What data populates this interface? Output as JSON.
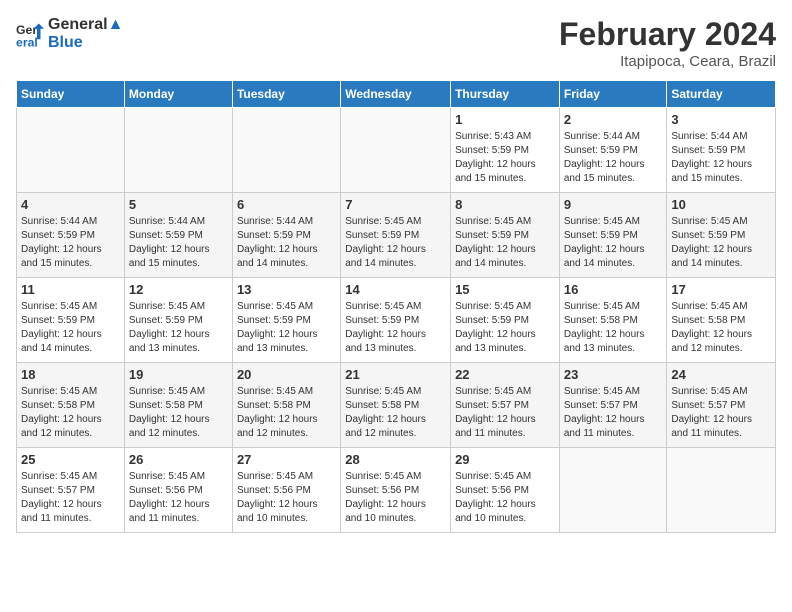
{
  "header": {
    "logo_line1": "General",
    "logo_line2": "Blue",
    "month_year": "February 2024",
    "location": "Itapipoca, Ceara, Brazil"
  },
  "weekdays": [
    "Sunday",
    "Monday",
    "Tuesday",
    "Wednesday",
    "Thursday",
    "Friday",
    "Saturday"
  ],
  "weeks": [
    [
      {
        "day": "",
        "info": ""
      },
      {
        "day": "",
        "info": ""
      },
      {
        "day": "",
        "info": ""
      },
      {
        "day": "",
        "info": ""
      },
      {
        "day": "1",
        "info": "Sunrise: 5:43 AM\nSunset: 5:59 PM\nDaylight: 12 hours\nand 15 minutes."
      },
      {
        "day": "2",
        "info": "Sunrise: 5:44 AM\nSunset: 5:59 PM\nDaylight: 12 hours\nand 15 minutes."
      },
      {
        "day": "3",
        "info": "Sunrise: 5:44 AM\nSunset: 5:59 PM\nDaylight: 12 hours\nand 15 minutes."
      }
    ],
    [
      {
        "day": "4",
        "info": "Sunrise: 5:44 AM\nSunset: 5:59 PM\nDaylight: 12 hours\nand 15 minutes."
      },
      {
        "day": "5",
        "info": "Sunrise: 5:44 AM\nSunset: 5:59 PM\nDaylight: 12 hours\nand 15 minutes."
      },
      {
        "day": "6",
        "info": "Sunrise: 5:44 AM\nSunset: 5:59 PM\nDaylight: 12 hours\nand 14 minutes."
      },
      {
        "day": "7",
        "info": "Sunrise: 5:45 AM\nSunset: 5:59 PM\nDaylight: 12 hours\nand 14 minutes."
      },
      {
        "day": "8",
        "info": "Sunrise: 5:45 AM\nSunset: 5:59 PM\nDaylight: 12 hours\nand 14 minutes."
      },
      {
        "day": "9",
        "info": "Sunrise: 5:45 AM\nSunset: 5:59 PM\nDaylight: 12 hours\nand 14 minutes."
      },
      {
        "day": "10",
        "info": "Sunrise: 5:45 AM\nSunset: 5:59 PM\nDaylight: 12 hours\nand 14 minutes."
      }
    ],
    [
      {
        "day": "11",
        "info": "Sunrise: 5:45 AM\nSunset: 5:59 PM\nDaylight: 12 hours\nand 14 minutes."
      },
      {
        "day": "12",
        "info": "Sunrise: 5:45 AM\nSunset: 5:59 PM\nDaylight: 12 hours\nand 13 minutes."
      },
      {
        "day": "13",
        "info": "Sunrise: 5:45 AM\nSunset: 5:59 PM\nDaylight: 12 hours\nand 13 minutes."
      },
      {
        "day": "14",
        "info": "Sunrise: 5:45 AM\nSunset: 5:59 PM\nDaylight: 12 hours\nand 13 minutes."
      },
      {
        "day": "15",
        "info": "Sunrise: 5:45 AM\nSunset: 5:59 PM\nDaylight: 12 hours\nand 13 minutes."
      },
      {
        "day": "16",
        "info": "Sunrise: 5:45 AM\nSunset: 5:58 PM\nDaylight: 12 hours\nand 13 minutes."
      },
      {
        "day": "17",
        "info": "Sunrise: 5:45 AM\nSunset: 5:58 PM\nDaylight: 12 hours\nand 12 minutes."
      }
    ],
    [
      {
        "day": "18",
        "info": "Sunrise: 5:45 AM\nSunset: 5:58 PM\nDaylight: 12 hours\nand 12 minutes."
      },
      {
        "day": "19",
        "info": "Sunrise: 5:45 AM\nSunset: 5:58 PM\nDaylight: 12 hours\nand 12 minutes."
      },
      {
        "day": "20",
        "info": "Sunrise: 5:45 AM\nSunset: 5:58 PM\nDaylight: 12 hours\nand 12 minutes."
      },
      {
        "day": "21",
        "info": "Sunrise: 5:45 AM\nSunset: 5:58 PM\nDaylight: 12 hours\nand 12 minutes."
      },
      {
        "day": "22",
        "info": "Sunrise: 5:45 AM\nSunset: 5:57 PM\nDaylight: 12 hours\nand 11 minutes."
      },
      {
        "day": "23",
        "info": "Sunrise: 5:45 AM\nSunset: 5:57 PM\nDaylight: 12 hours\nand 11 minutes."
      },
      {
        "day": "24",
        "info": "Sunrise: 5:45 AM\nSunset: 5:57 PM\nDaylight: 12 hours\nand 11 minutes."
      }
    ],
    [
      {
        "day": "25",
        "info": "Sunrise: 5:45 AM\nSunset: 5:57 PM\nDaylight: 12 hours\nand 11 minutes."
      },
      {
        "day": "26",
        "info": "Sunrise: 5:45 AM\nSunset: 5:56 PM\nDaylight: 12 hours\nand 11 minutes."
      },
      {
        "day": "27",
        "info": "Sunrise: 5:45 AM\nSunset: 5:56 PM\nDaylight: 12 hours\nand 10 minutes."
      },
      {
        "day": "28",
        "info": "Sunrise: 5:45 AM\nSunset: 5:56 PM\nDaylight: 12 hours\nand 10 minutes."
      },
      {
        "day": "29",
        "info": "Sunrise: 5:45 AM\nSunset: 5:56 PM\nDaylight: 12 hours\nand 10 minutes."
      },
      {
        "day": "",
        "info": ""
      },
      {
        "day": "",
        "info": ""
      }
    ]
  ]
}
